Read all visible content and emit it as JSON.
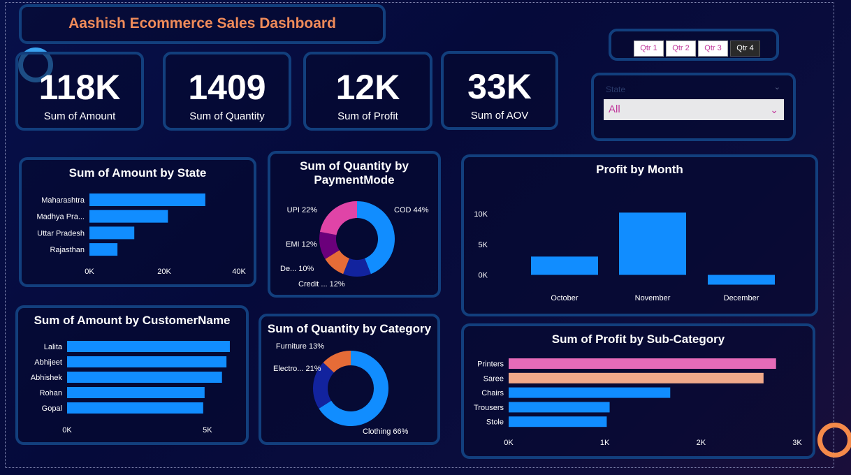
{
  "dashboard": {
    "title": "Aashish Ecommerce Sales Dashboard"
  },
  "kpis": [
    {
      "value": "118K",
      "label": "Sum of Amount"
    },
    {
      "value": "1409",
      "label": "Sum of Quantity"
    },
    {
      "value": "12K",
      "label": "Sum of Profit"
    },
    {
      "value": "33K",
      "label": "Sum of AOV"
    }
  ],
  "quarter_slicer": {
    "options": [
      "Qtr 1",
      "Qtr 2",
      "Qtr 3",
      "Qtr 4"
    ],
    "selected": "Qtr 4"
  },
  "state_slicer": {
    "label": "State",
    "value": "All"
  },
  "colors": {
    "bar_blue": "#118dff",
    "pink": "#e66bb8",
    "peach": "#f0a98a",
    "title_orange": "#f08b5a",
    "panel_border": "#123f7d"
  },
  "chart_data": [
    {
      "type": "bar",
      "orientation": "horizontal",
      "title": "Sum of Amount by State",
      "categories": [
        "Maharashtra",
        "Madhya Pra...",
        "Uttar Pradesh",
        "Rajasthan"
      ],
      "values": [
        31000,
        21000,
        12000,
        7500
      ],
      "ticks": [
        "0K",
        "20K",
        "40K"
      ],
      "xlim": [
        0,
        40000
      ]
    },
    {
      "type": "pie",
      "donut": true,
      "title": "Sum of Quantity by PaymentMode",
      "labels": [
        "COD 44%",
        "Credit ... 12%",
        "De... 10%",
        "EMI 12%",
        "UPI 22%"
      ],
      "values": [
        44,
        12,
        10,
        12,
        22
      ],
      "colors": [
        "#118dff",
        "#12239e",
        "#e66c37",
        "#6b007b",
        "#e044a7"
      ]
    },
    {
      "type": "bar",
      "title": "Profit by Month",
      "categories": [
        "October",
        "November",
        "December"
      ],
      "values": [
        3000,
        10200,
        -1600
      ],
      "ticks": [
        "0K",
        "5K",
        "10K"
      ],
      "ylim": [
        -2000,
        11500
      ]
    },
    {
      "type": "bar",
      "orientation": "horizontal",
      "title": "Sum of Amount by CustomerName",
      "categories": [
        "Lalita",
        "Abhijeet",
        "Abhishek",
        "Rohan",
        "Gopal"
      ],
      "values": [
        5800,
        5680,
        5520,
        4900,
        4850
      ],
      "ticks": [
        "0K",
        "5K"
      ],
      "xlim": [
        0,
        6000
      ]
    },
    {
      "type": "pie",
      "donut": true,
      "title": "Sum of Quantity by Category",
      "labels": [
        "Clothing 66%",
        "Electro... 21%",
        "Furniture 13%"
      ],
      "values": [
        66,
        21,
        13
      ],
      "colors": [
        "#118dff",
        "#12239e",
        "#e66c37"
      ]
    },
    {
      "type": "bar",
      "orientation": "horizontal",
      "title": "Sum of Profit by Sub-Category",
      "categories": [
        "Printers",
        "Saree",
        "Chairs",
        "Trousers",
        "Stole"
      ],
      "values": [
        2780,
        2650,
        1680,
        1050,
        1020
      ],
      "colors": [
        "#e66bb8",
        "#f0a98a",
        "#118dff",
        "#118dff",
        "#118dff"
      ],
      "ticks": [
        "0K",
        "1K",
        "2K",
        "3K"
      ],
      "xlim": [
        0,
        3000
      ]
    }
  ]
}
